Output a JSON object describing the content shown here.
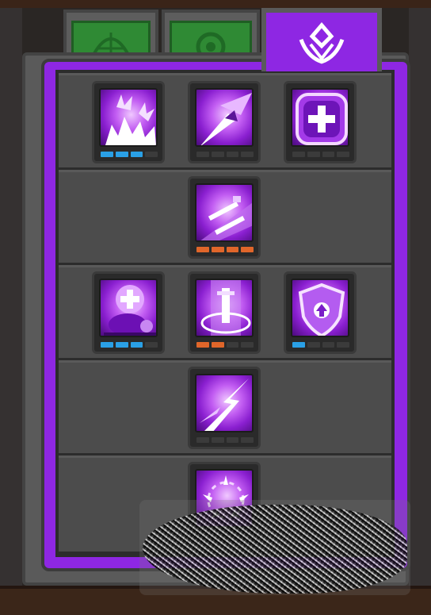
{
  "tabs": [
    {
      "id": "bow",
      "icon": "bow-icon",
      "active": false
    },
    {
      "id": "swirl",
      "icon": "swirl-icon",
      "active": false
    },
    {
      "id": "crest",
      "icon": "crest-icon",
      "active": true
    }
  ],
  "colors": {
    "accent": "#8e27e3",
    "tab_inactive": "#2f8a34",
    "pip_blue": "#2aa0e6",
    "pip_orange": "#e0662a",
    "pip_empty": "#3b3b3b"
  },
  "skill_rows": [
    {
      "skills": [
        {
          "name": "burst-explosion",
          "icon": "explosion-icon",
          "level": 3,
          "max": 5,
          "pip_color": "blue"
        },
        {
          "name": "arrow-strike",
          "icon": "arrow-strike-icon",
          "level": 0,
          "max": 5,
          "pip_color": "blue"
        },
        {
          "name": "heal-cross",
          "icon": "heal-cross-icon",
          "level": 0,
          "max": 5,
          "pip_color": "blue"
        }
      ]
    },
    {
      "skills": [
        {
          "name": "twin-swords",
          "icon": "twin-swords-icon",
          "level": 4,
          "max": 4,
          "pip_color": "orange"
        }
      ]
    },
    {
      "skills": [
        {
          "name": "pet-heal",
          "icon": "pet-heal-icon",
          "level": 3,
          "max": 5,
          "pip_color": "blue"
        },
        {
          "name": "sword-pillar",
          "icon": "sword-pillar-icon",
          "level": 2,
          "max": 5,
          "pip_color": "orange"
        },
        {
          "name": "shield-up",
          "icon": "shield-up-icon",
          "level": 1,
          "max": 5,
          "pip_color": "blue"
        }
      ]
    },
    {
      "skills": [
        {
          "name": "lightning-dash",
          "icon": "lightning-dash-icon",
          "level": 0,
          "max": 5,
          "pip_color": "blue"
        }
      ]
    },
    {
      "skills": [
        {
          "name": "blade-ring",
          "icon": "blade-ring-icon",
          "level": 0,
          "max": 5,
          "pip_color": "blue"
        }
      ]
    }
  ]
}
